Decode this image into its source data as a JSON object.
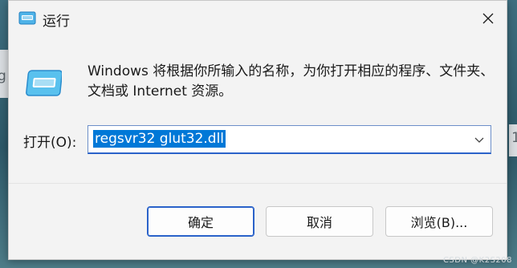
{
  "window": {
    "title": "运行",
    "close_icon": "close-icon",
    "title_icon": "run-app-icon"
  },
  "body": {
    "description": "Windows 将根据你所输入的名称，为你打开相应的程序、文件夹、文档或 Internet 资源。",
    "icon": "run-program-icon"
  },
  "open_field": {
    "label": "打开(O):",
    "value": "regsvr32 glut32.dll",
    "dropdown_icon": "chevron-down-icon"
  },
  "buttons": {
    "ok": "确定",
    "cancel": "取消",
    "browse": "浏览(B)..."
  },
  "background": {
    "left_fragment": "g",
    "right_fragment": "1",
    "watermark": "CSDN @K2S208"
  },
  "colors": {
    "selection": "#0078d7",
    "focus_border": "#2a62c9",
    "dialog_bg": "#f3f3f3"
  }
}
